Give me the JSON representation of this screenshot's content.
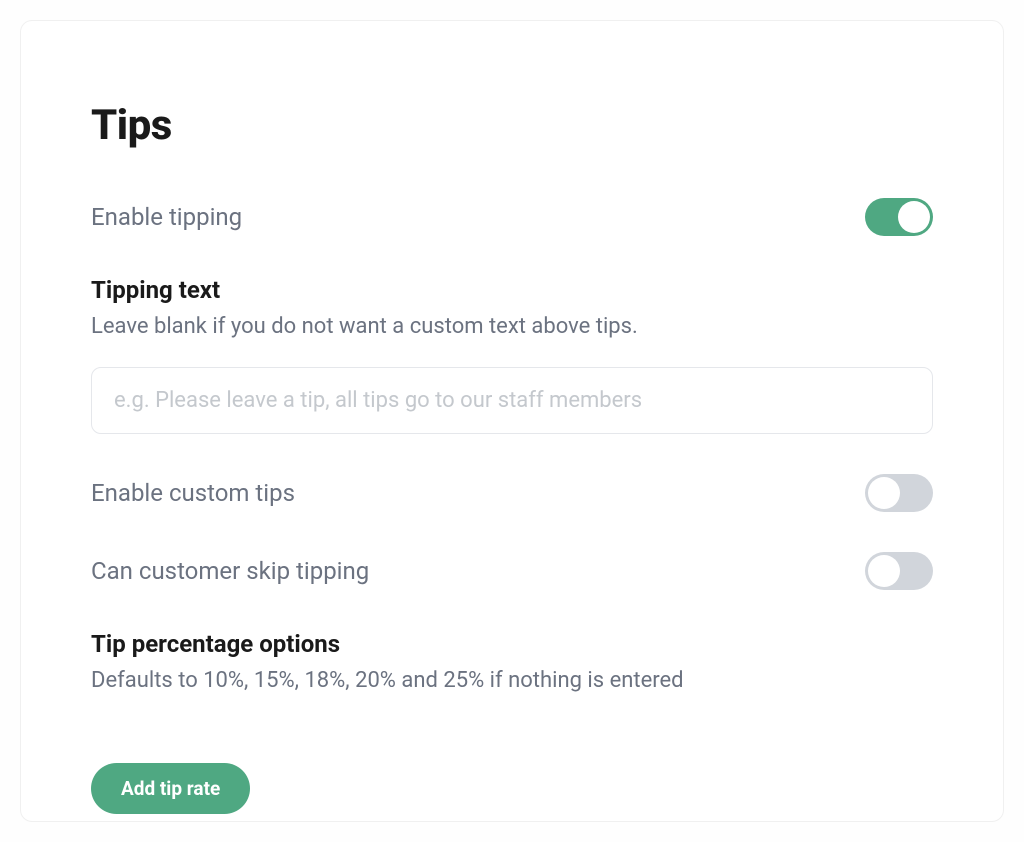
{
  "title": "Tips",
  "settings": {
    "enable_tipping": {
      "label": "Enable tipping",
      "value": true
    },
    "tipping_text": {
      "heading": "Tipping text",
      "subtext": "Leave blank if you do not want a custom text above tips.",
      "placeholder": "e.g. Please leave a tip, all tips go to our staff members",
      "value": ""
    },
    "enable_custom_tips": {
      "label": "Enable custom tips",
      "value": false
    },
    "can_skip_tipping": {
      "label": "Can customer skip tipping",
      "value": false
    },
    "tip_percentage": {
      "heading": "Tip percentage options",
      "subtext": "Defaults to 10%, 15%, 18%, 20% and 25% if nothing is entered"
    }
  },
  "buttons": {
    "add_tip_rate": "Add tip rate"
  }
}
